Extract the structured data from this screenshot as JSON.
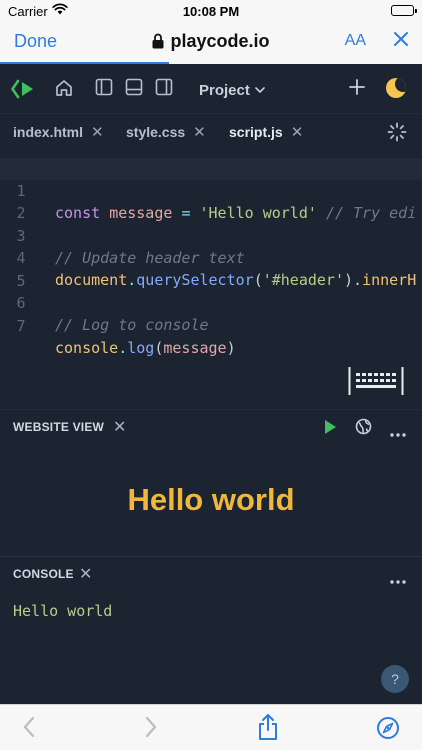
{
  "status": {
    "carrier": "Carrier",
    "time": "10:08 PM"
  },
  "safari": {
    "done_label": "Done",
    "url": "playcode.io",
    "text_size_label": "AA",
    "progress": 0.4
  },
  "toolbar": {
    "project_label": "Project"
  },
  "tabs": [
    {
      "label": "index.html",
      "active": false
    },
    {
      "label": "style.css",
      "active": false
    },
    {
      "label": "script.js",
      "active": true
    }
  ],
  "code": {
    "line_numbers": [
      "1",
      "2",
      "3",
      "4",
      "5",
      "6",
      "7"
    ],
    "l1": {
      "kw": "const",
      "var": "message",
      "op": "=",
      "str": "'Hello world'",
      "comment": "// Try edi"
    },
    "l3": {
      "comment": "// Update header text"
    },
    "l4": {
      "obj": "document",
      "dot": ".",
      "fn": "querySelector",
      "open": "(",
      "str": "'#header'",
      "close": ").",
      "prop": "innerH"
    },
    "l6": {
      "comment": "// Log to console"
    },
    "l7": {
      "obj": "console",
      "dot": ".",
      "fn": "log",
      "open": "(",
      "var": "message",
      "close": ")"
    }
  },
  "website_view": {
    "title": "WEBSITE VIEW",
    "heading": "Hello world"
  },
  "console": {
    "title": "CONSOLE",
    "output": "Hello world"
  },
  "help": {
    "label": "?"
  },
  "colors": {
    "accent": "#2f7be0",
    "app_bg": "#1b2430",
    "heading": "#f0b73d",
    "console_text": "#b4cf8a",
    "logo_green": "#3fbf5f"
  }
}
